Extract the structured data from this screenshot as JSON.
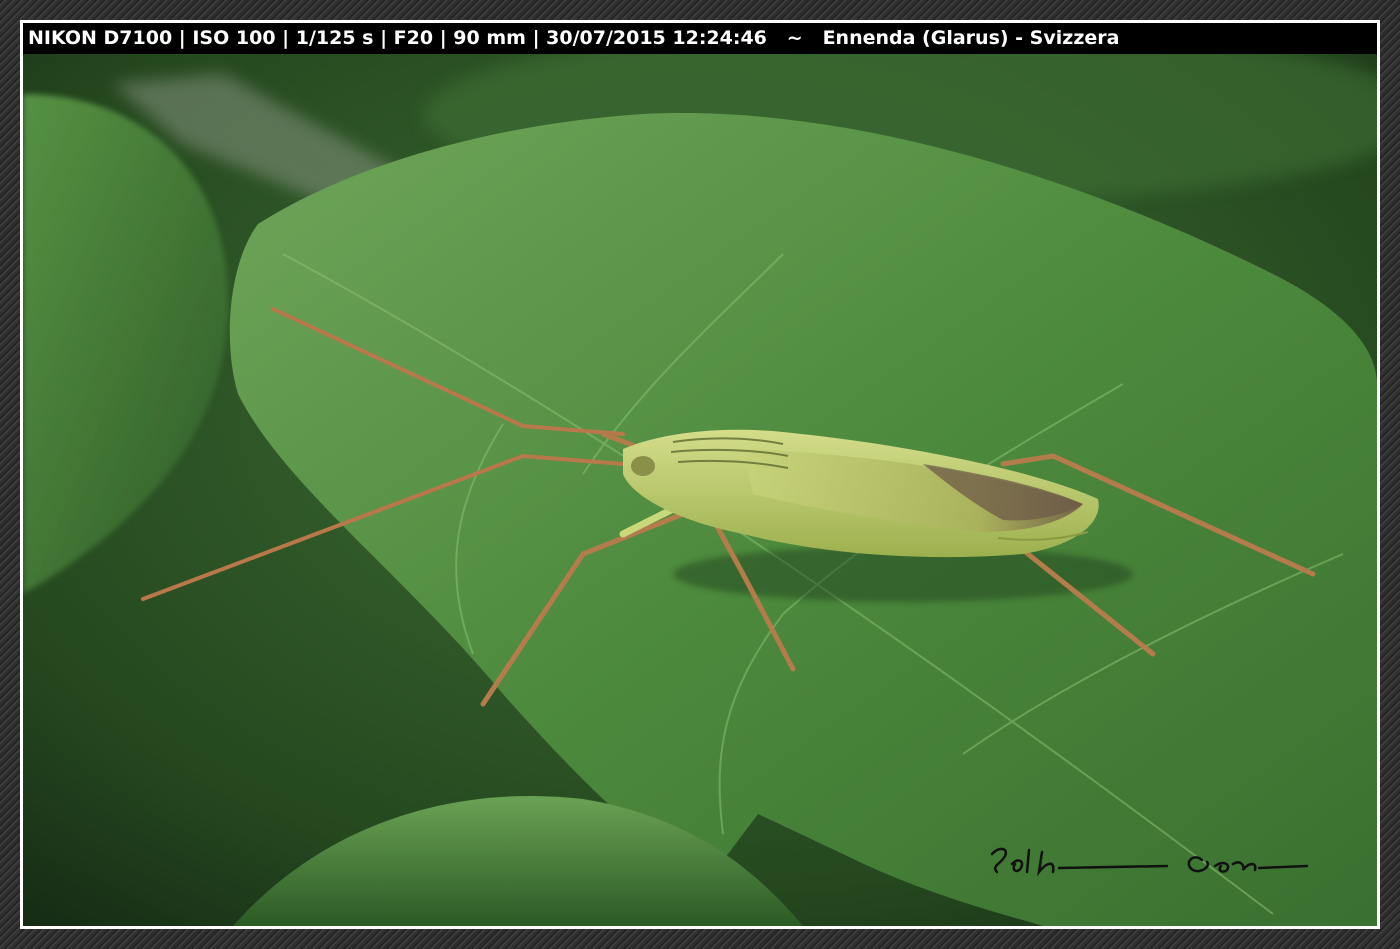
{
  "exif": {
    "camera": "NIKON D7100",
    "iso": "ISO 100",
    "shutter": "1/125 s",
    "aperture": "F20",
    "focal": "90 mm",
    "datetime": "30/07/2015 12:24:46",
    "separator": "~",
    "location": "Ennenda (Glarus) - Svizzera"
  },
  "colors": {
    "leaf_main": "#4f8a3e",
    "leaf_light": "#7fb064",
    "bg_dark": "#1f3a1c",
    "bug_body": "#b8cc6a",
    "bug_legs": "#b07a4a",
    "frame_border": "#ffffff"
  },
  "icons": {
    "signature": "handwritten-signature-icon"
  }
}
